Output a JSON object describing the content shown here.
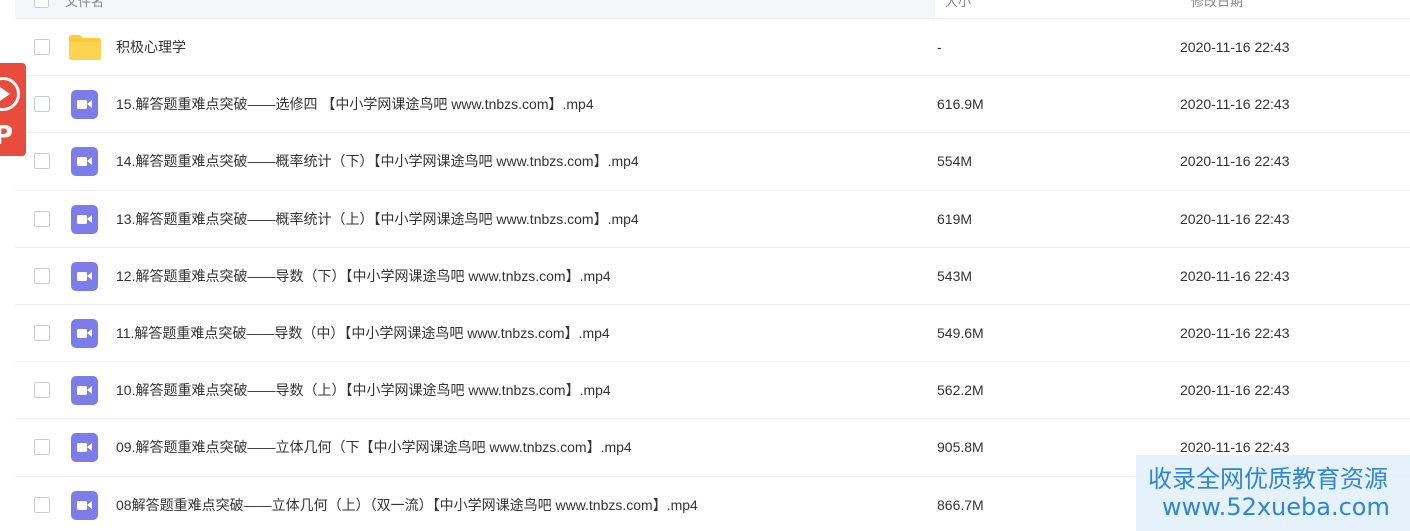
{
  "header": {
    "name_label": "文件名",
    "size_label": "大小",
    "date_label": "修改日期"
  },
  "rows": [
    {
      "type": "folder",
      "name": "积极心理学",
      "size": "-",
      "date": "2020-11-16 22:43"
    },
    {
      "type": "video",
      "name": "15.解答题重难点突破——选修四 【中小学网课途鸟吧 www.tnbzs.com】.mp4",
      "size": "616.9M",
      "date": "2020-11-16 22:43"
    },
    {
      "type": "video",
      "name": "14.解答题重难点突破——概率统计（下）【中小学网课途鸟吧 www.tnbzs.com】.mp4",
      "size": "554M",
      "date": "2020-11-16 22:43"
    },
    {
      "type": "video",
      "name": "13.解答题重难点突破——概率统计（上）【中小学网课途鸟吧 www.tnbzs.com】.mp4",
      "size": "619M",
      "date": "2020-11-16 22:43"
    },
    {
      "type": "video",
      "name": "12.解答题重难点突破——导数（下）【中小学网课途鸟吧 www.tnbzs.com】.mp4",
      "size": "543M",
      "date": "2020-11-16 22:43"
    },
    {
      "type": "video",
      "name": "11.解答题重难点突破——导数（中）【中小学网课途鸟吧 www.tnbzs.com】.mp4",
      "size": "549.6M",
      "date": "2020-11-16 22:43"
    },
    {
      "type": "video",
      "name": "10.解答题重难点突破——导数（上）【中小学网课途鸟吧 www.tnbzs.com】.mp4",
      "size": "562.2M",
      "date": "2020-11-16 22:43"
    },
    {
      "type": "video",
      "name": "09.解答题重难点突破——立体几何（下【中小学网课途鸟吧 www.tnbzs.com】.mp4",
      "size": "905.8M",
      "date": "2020-11-16 22:43"
    },
    {
      "type": "video",
      "name": "08解答题重难点突破——立体几何（上）（双一流）【中小学网课途鸟吧 www.tnbzs.com】.mp4",
      "size": "866.7M",
      "date": ""
    }
  ],
  "side_badge": {
    "letter": "P",
    "icon": "play-circle-icon"
  },
  "watermark": {
    "line1": "收录全网优质教育资源",
    "line2": "www.52xueba.com"
  },
  "colors": {
    "video_icon": "#7c7de8",
    "folder_icon": "#ffc83d",
    "badge": "#e84c3d",
    "watermark_text": "#2f86d6"
  }
}
